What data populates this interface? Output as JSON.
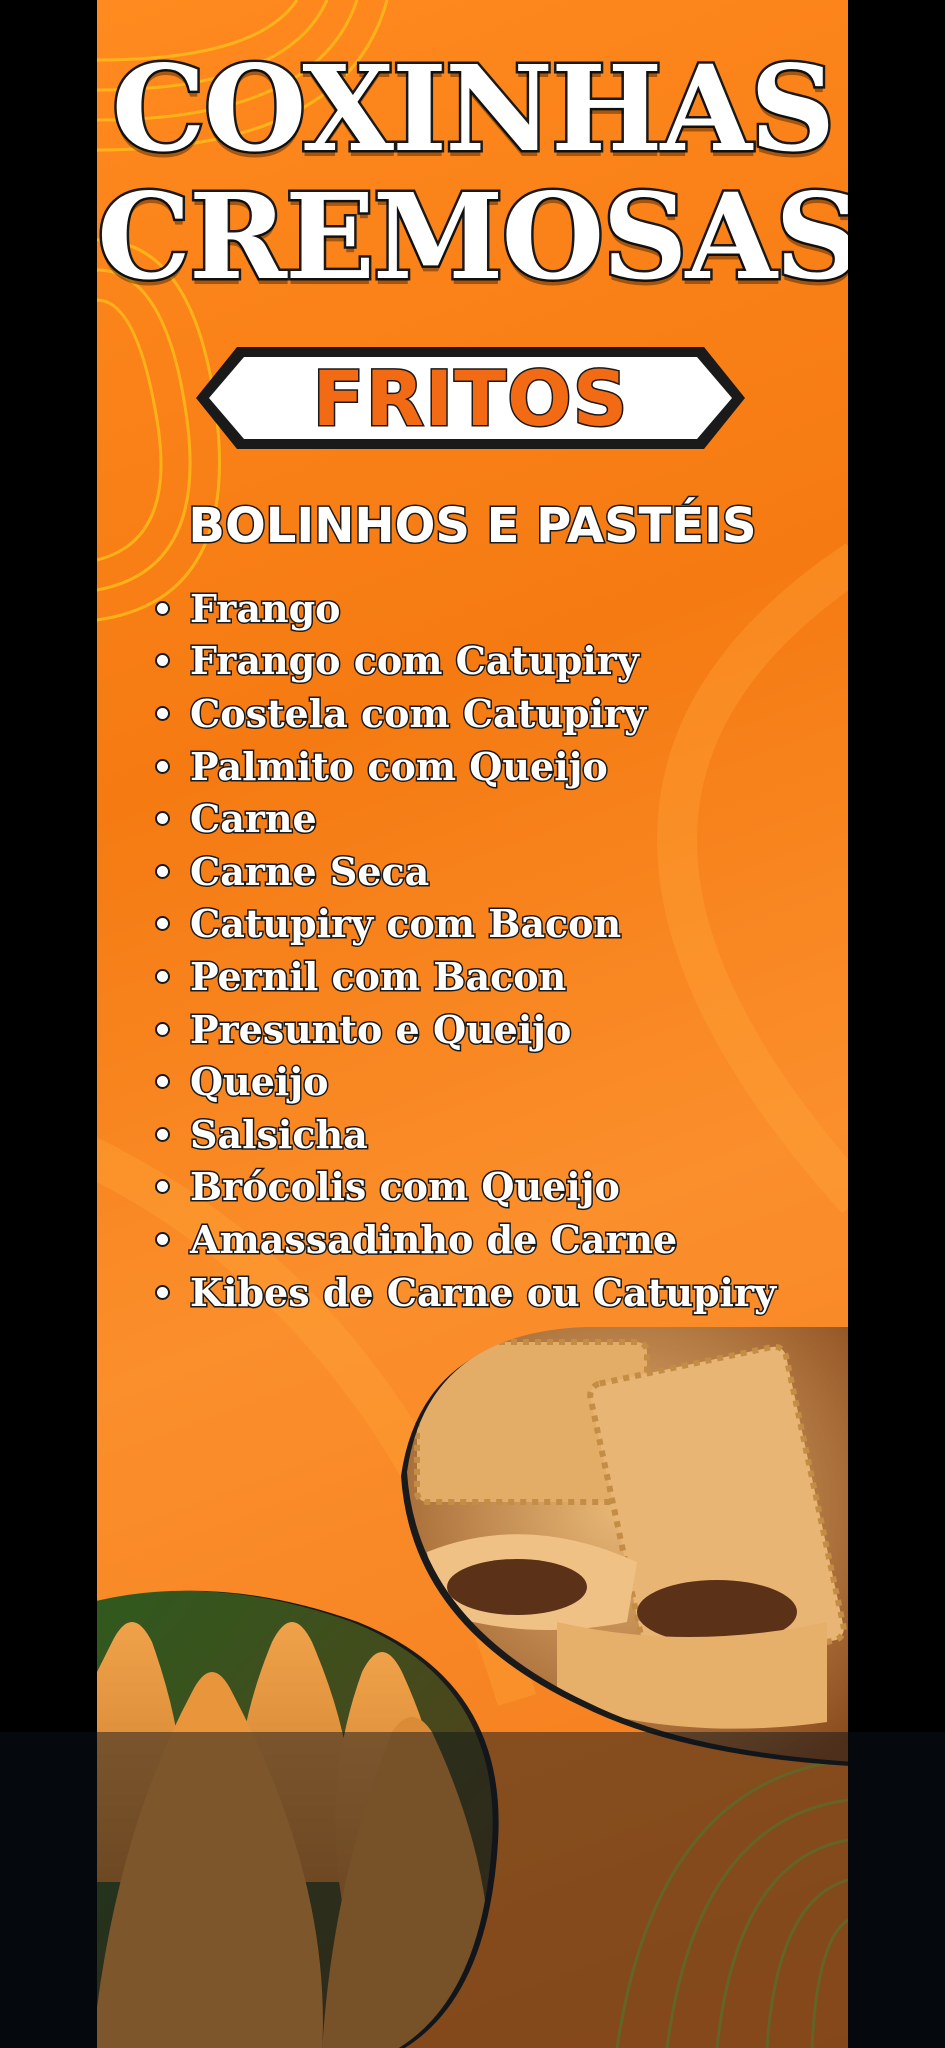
{
  "flyer": {
    "title_line1": "COXINHAS",
    "title_line2": "CREMOSAS",
    "banner_label": "FRITOS",
    "subtitle": "BOLINHOS E PASTÉIS",
    "items": [
      "Frango",
      "Frango com Catupiry",
      "Costela com Catupiry",
      "Palmito com Queijo",
      "Carne",
      "Carne Seca",
      "Catupiry com Bacon",
      "Pernil com Bacon",
      "Presunto e Queijo",
      "Queijo",
      "Salsicha",
      "Brócolis com Queijo",
      "Amassadinho de Carne",
      "Kibes de Carne ou Catupiry"
    ],
    "colors": {
      "background": "#f57a12",
      "title_fill": "#ffffff",
      "banner_text": "#f26a13",
      "outline": "#1a1a1a"
    },
    "images": {
      "pastel": "pastel-photo",
      "coxinha": "coxinha-photo"
    }
  }
}
